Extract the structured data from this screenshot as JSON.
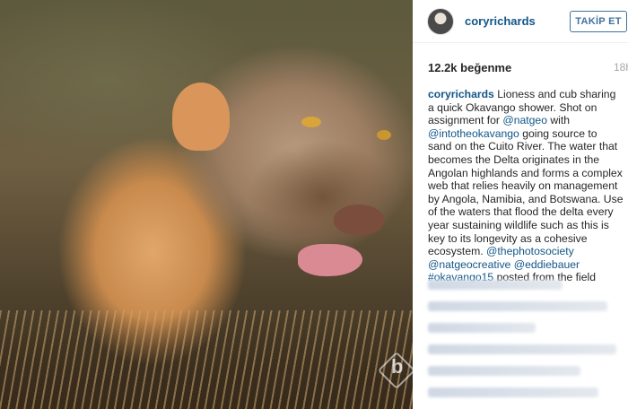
{
  "post": {
    "username": "coryrichards",
    "follow_label": "TAKİP ET",
    "likes": "12.2k beğenme",
    "time_ago": "18h",
    "caption": {
      "author": "coryrichards",
      "text1": " Lioness and cub sharing a quick Okavango shower. Shot on assignment for ",
      "mention1": "@natgeo",
      "text2": " with ",
      "mention2": "@intotheokavango",
      "text3": " going source to sand on the Cuito River. The water that becomes the Delta originates in the Angolan highlands and forms a complex web that relies heavily on management by Angola, Namibia, and Botswana. Use of the waters that flood the delta every year sustaining wildlife such as this is key to its longevity as a cohesive ecosystem. ",
      "mention3": "@thephotosociety",
      "mention4": "@natgeocreative",
      "mention5": "@eddiebauer",
      "hashtag": "#okavango15",
      "text4": " posted from the field"
    },
    "watermark_letter": "b"
  }
}
